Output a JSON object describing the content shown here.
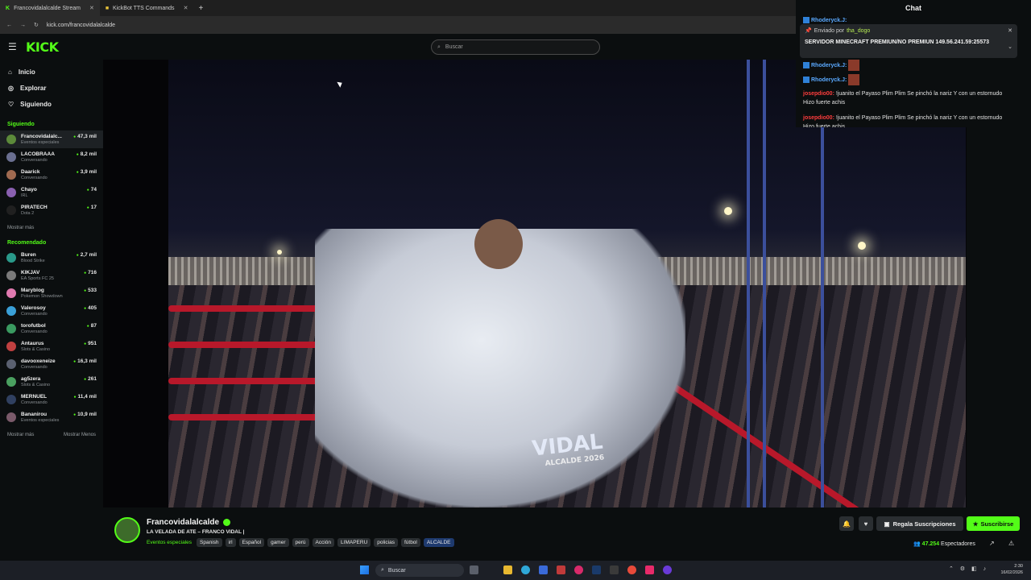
{
  "browser": {
    "tabs": [
      {
        "label": "Francovidalalcalde Stream",
        "icon": "kick-icon"
      },
      {
        "label": "KickBot TTS Commands",
        "icon": "bookmark-icon"
      }
    ],
    "url": "kick.com/francovidalalcalde"
  },
  "header": {
    "logo": "KICK",
    "search_placeholder": "Buscar"
  },
  "sidebar": {
    "nav": [
      {
        "label": "Inicio",
        "icon": "home-icon"
      },
      {
        "label": "Explorar",
        "icon": "compass-icon"
      },
      {
        "label": "Siguiendo",
        "icon": "heart-icon"
      }
    ],
    "following_title": "Siguiendo",
    "following": [
      {
        "name": "Francovidalalc...",
        "category": "Eventos especiales",
        "count": "47,3 mil",
        "color": "#5c8a3a"
      },
      {
        "name": "LACOBRAAA",
        "category": "Conversando",
        "count": "8,2 mil",
        "color": "#6a6f90"
      },
      {
        "name": "Daarick",
        "category": "Conversando",
        "count": "3,9 mil",
        "color": "#a06a50"
      },
      {
        "name": "Chayo",
        "category": "IRL",
        "count": "74",
        "color": "#8a60b0"
      },
      {
        "name": "PIRATECH",
        "category": "Dota 2",
        "count": "17",
        "color": "#202020"
      }
    ],
    "show_more": "Mostrar más",
    "recommended_title": "Recomendado",
    "recommended": [
      {
        "name": "Buren",
        "category": "Blood Strike",
        "count": "2,7 mil",
        "color": "#2a9a8a"
      },
      {
        "name": "KIKJAV",
        "category": "EA Sports FC 25",
        "count": "716",
        "color": "#7a7a7a"
      },
      {
        "name": "Maryblog",
        "category": "Pokemon Showdown",
        "count": "533",
        "color": "#e07ab0"
      },
      {
        "name": "Valerosoy",
        "category": "Conversando",
        "count": "405",
        "color": "#3aa0d8"
      },
      {
        "name": "torofutbol",
        "category": "Conversando",
        "count": "87",
        "color": "#3a9a60"
      },
      {
        "name": "Antaurus",
        "category": "Slots & Casino",
        "count": "951",
        "color": "#c04040"
      },
      {
        "name": "davooxeneize",
        "category": "Conversando",
        "count": "16,3 mil",
        "color": "#5a6070"
      },
      {
        "name": "ag5zera",
        "category": "Slots & Casino",
        "count": "261",
        "color": "#4aa060"
      },
      {
        "name": "MERNUEL",
        "category": "Conversando",
        "count": "11,4 mil",
        "color": "#304060"
      },
      {
        "name": "Bananirou",
        "category": "Eventos especiales",
        "count": "10,9 mil",
        "color": "#7a5a6a"
      }
    ],
    "show_more_2": "Mostrar más",
    "show_less": "Mostrar Menos"
  },
  "video": {
    "banner_line1": "VIDAL",
    "banner_line2": "ALCALDE 2026"
  },
  "chat": {
    "title": "Chat",
    "pinned_label": "Enviado por",
    "pinned_user": "tha_dogo",
    "pinned_message": "SERVIDOR MINECRAFT PREMIUN/NO PREMIUN 149.56.241.59:25573",
    "messages": [
      {
        "user": "Rhoderyck.J:",
        "text": "",
        "emote": true,
        "style": "blue"
      },
      {
        "user": "Rhoderyck.J:",
        "text": "",
        "emote": true,
        "style": "blue"
      },
      {
        "user": "josepdio00:",
        "text": "!juanito el Payaso Plim Plim Se pinchó la nariz Y con un estornudo Hizo fuerte achis",
        "emote": false,
        "style": "red"
      },
      {
        "user": "josepdio00:",
        "text": "!juanito el Payaso Plim Plim Se pinchó la nariz Y con un estornudo Hizo fuerte achis",
        "emote": false,
        "style": "red"
      }
    ]
  },
  "channel": {
    "name": "Francovidalalcalde",
    "title": "LA VELADA DE ATE – FRANCO VIDAL |",
    "category": "Eventos especiales",
    "tags": [
      "Spanish",
      "irl",
      "Español",
      "gamer",
      "perú",
      "Acción",
      "LIMAPERU",
      "policias",
      "fútbol",
      "ALCALDE"
    ],
    "gift_label": "Regala Suscripciones",
    "subscribe_label": "Suscribirse",
    "viewers": "47.254",
    "viewers_label": "Espectadores"
  },
  "taskbar": {
    "search_placeholder": "Buscar",
    "time": "2:30",
    "date": "16/02/2026"
  }
}
